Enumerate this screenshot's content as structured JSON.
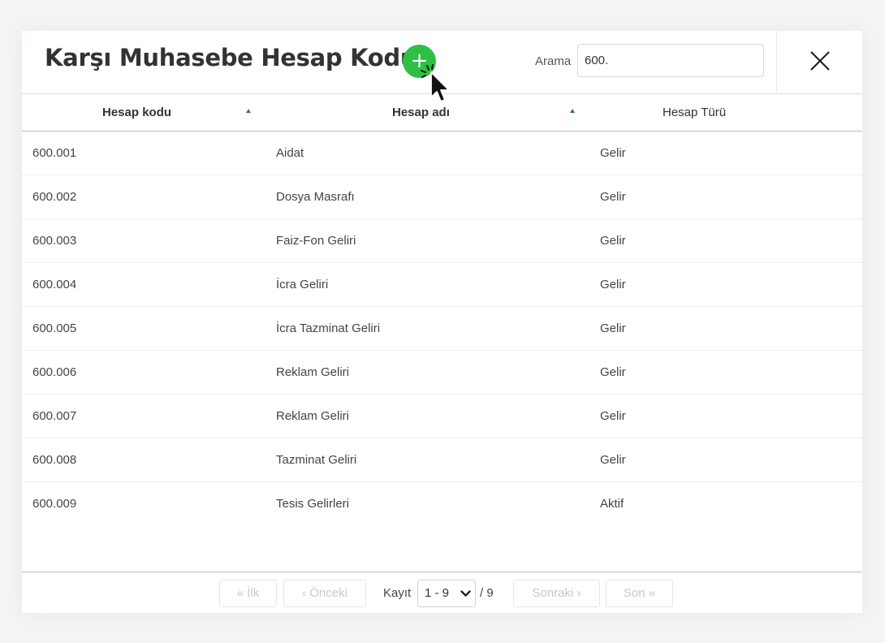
{
  "dialog": {
    "title": "Karşı Muhasebe Hesap Kodu",
    "add_label": "+",
    "search": {
      "label": "Arama",
      "value": "600."
    },
    "close_icon": "close-icon"
  },
  "table": {
    "columns": [
      {
        "label": "Hesap kodu",
        "sortable": true
      },
      {
        "label": "Hesap adı",
        "sortable": true
      },
      {
        "label": "Hesap Türü",
        "sortable": false
      }
    ],
    "rows": [
      {
        "code": "600.001",
        "name": "Aidat",
        "type": "Gelir"
      },
      {
        "code": "600.002",
        "name": "Dosya Masrafı",
        "type": "Gelir"
      },
      {
        "code": "600.003",
        "name": "Faiz-Fon Geliri",
        "type": "Gelir"
      },
      {
        "code": "600.004",
        "name": "İcra Geliri",
        "type": "Gelir"
      },
      {
        "code": "600.005",
        "name": "İcra Tazminat Geliri",
        "type": "Gelir"
      },
      {
        "code": "600.006",
        "name": "Reklam Geliri",
        "type": "Gelir"
      },
      {
        "code": "600.007",
        "name": "Reklam Geliri",
        "type": "Gelir"
      },
      {
        "code": "600.008",
        "name": "Tazminat Geliri",
        "type": "Gelir"
      },
      {
        "code": "600.009",
        "name": "Tesis Gelirleri",
        "type": "Aktif"
      }
    ]
  },
  "pagination": {
    "first": "« İlk",
    "prev": "‹ Önceki",
    "record_label": "Kayıt",
    "range": "1 - 9",
    "total": "/ 9",
    "next": "Sonraki ›",
    "last": "Son »"
  },
  "colors": {
    "add_button": "#2ebf45",
    "sort_arrow": "#2f6f8f",
    "divider": "#a9c1d6"
  }
}
